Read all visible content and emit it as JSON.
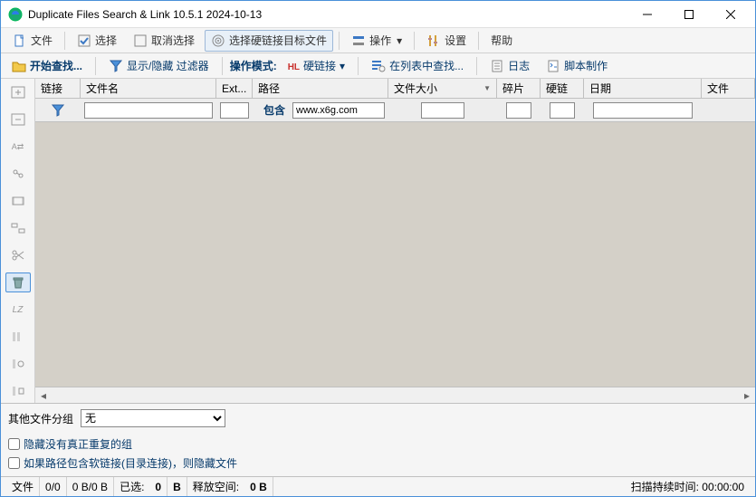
{
  "window": {
    "title": "Duplicate Files Search & Link 10.5.1 2024-10-13"
  },
  "toolbar1": {
    "file": "文件",
    "select": "选择",
    "deselect": "取消选择",
    "select_hardlink_target": "选择硬链接目标文件",
    "operate": "操作",
    "settings": "设置",
    "help": "帮助"
  },
  "toolbar2": {
    "start_search": "开始查找...",
    "show_hide_filters": "显示/隐藏 过滤器",
    "op_mode_label": "操作模式:",
    "hardlink": "硬链接",
    "search_in_list": "在列表中查找...",
    "log": "日志",
    "script_maker": "脚本制作"
  },
  "columns": {
    "c0": "链接",
    "c1": "文件名",
    "c2": "Ext...",
    "c3": "路径",
    "c4": "文件大小",
    "c5": "碎片",
    "c6": "硬链",
    "c7": "日期",
    "c8": "文件"
  },
  "filter": {
    "contains_label": "包含",
    "path_value": "www.x6g.com"
  },
  "bottom": {
    "group_label": "其他文件分组",
    "group_value": "无",
    "cb1": "隐藏没有真正重复的组",
    "cb2": "如果路径包含软链接(目录连接)，则隐藏文件"
  },
  "status": {
    "file_label": "文件",
    "count": "0/0",
    "size": "0 B/0 B",
    "selected_label": "已选:",
    "selected_count": "0",
    "b2": "B",
    "freed_label": "释放空间:",
    "freed_value": "0 B",
    "scan_label": "扫描持续时间:",
    "scan_time": "00:00:00"
  }
}
